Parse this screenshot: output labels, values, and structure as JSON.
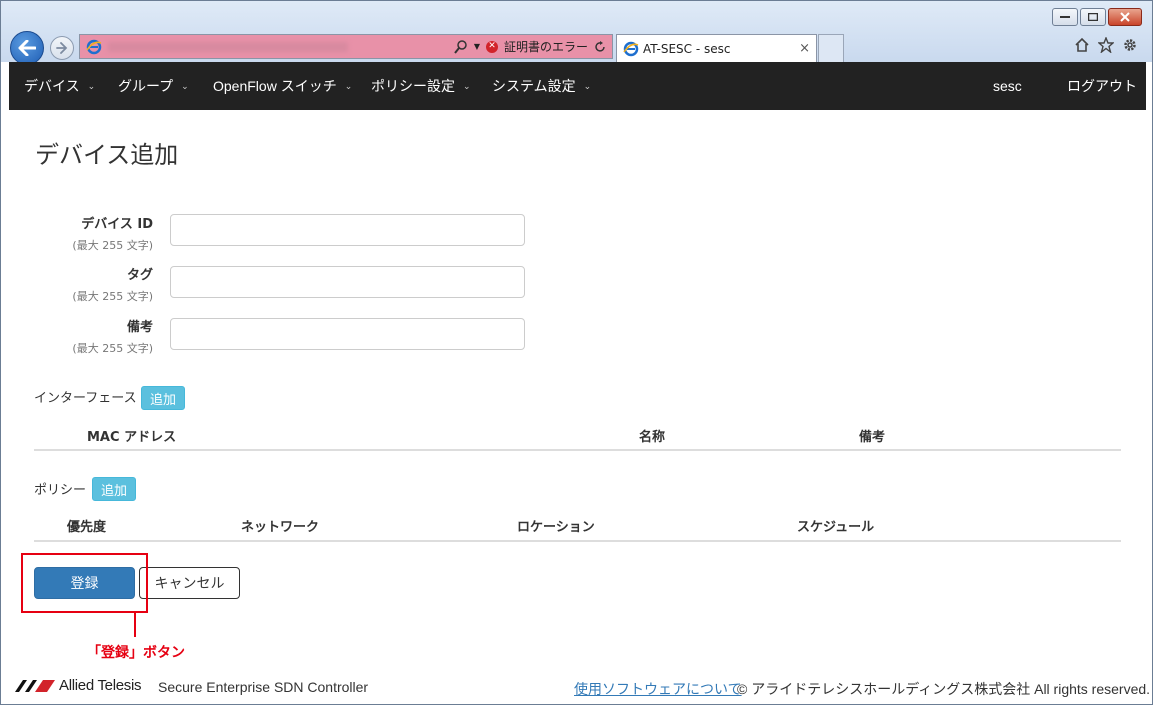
{
  "browser": {
    "tab_title": "AT-SESC - sesc",
    "cert_error": "証明書のエラー",
    "tab_close": "×"
  },
  "nav": {
    "items": [
      {
        "label": "デバイス"
      },
      {
        "label": "グループ"
      },
      {
        "label": "OpenFlow スイッチ"
      },
      {
        "label": "ポリシー設定"
      },
      {
        "label": "システム設定"
      }
    ],
    "user": "sesc",
    "logout": "ログアウト"
  },
  "page": {
    "title": "デバイス追加"
  },
  "form": {
    "fields": [
      {
        "label": "デバイス ID",
        "hint": "(最大 255 文字)",
        "value": ""
      },
      {
        "label": "タグ",
        "hint": "(最大 255 文字)",
        "value": ""
      },
      {
        "label": "備考",
        "hint": "(最大 255 文字)",
        "value": ""
      }
    ]
  },
  "interface": {
    "label": "インターフェース",
    "add_label": "追加",
    "columns": [
      "MAC アドレス",
      "名称",
      "備考"
    ]
  },
  "policy": {
    "label": "ポリシー",
    "add_label": "追加",
    "columns": [
      "優先度",
      "ネットワーク",
      "ロケーション",
      "スケジュール"
    ]
  },
  "actions": {
    "submit": "登録",
    "cancel": "キャンセル"
  },
  "callout": {
    "text": "「登録」ボタン",
    "color": "#e60012"
  },
  "footer": {
    "brand": "Allied Telesis",
    "product": "Secure Enterprise SDN Controller",
    "software_link": "使用ソフトウェアについて",
    "copyright": "© アライドテレシスホールディングス株式会社 All rights reserved."
  },
  "colors": {
    "nav_bg": "#222222",
    "primary": "#337ab7",
    "info": "#5bc0de",
    "address_error": "#e891a8"
  }
}
